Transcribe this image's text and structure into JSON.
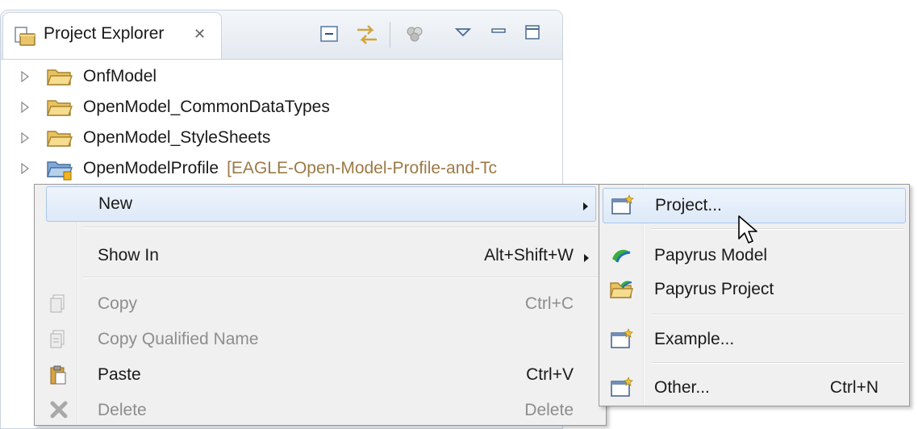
{
  "view": {
    "tab_label": "Project Explorer",
    "tab_close_glyph": "✕",
    "toolbar": [
      "collapse-all-icon",
      "link-with-editor-icon",
      "filters-icon",
      "view-menu-icon",
      "minimize-icon",
      "maximize-icon"
    ]
  },
  "tree": [
    {
      "label": "OnfModel",
      "decoration": "",
      "icon": "folder-icon"
    },
    {
      "label": "OpenModel_CommonDataTypes",
      "decoration": "",
      "icon": "folder-icon"
    },
    {
      "label": "OpenModel_StyleSheets",
      "decoration": "",
      "icon": "folder-icon"
    },
    {
      "label": "OpenModelProfile",
      "decoration": "[EAGLE-Open-Model-Profile-and-Tc",
      "icon": "shared-project-icon"
    }
  ],
  "context_menu": {
    "items": [
      {
        "label": "New",
        "shortcut": "",
        "submenu": true,
        "enabled": true
      },
      {
        "label": "Show In",
        "shortcut": "Alt+Shift+W",
        "submenu": true,
        "enabled": true
      },
      {
        "label": "Copy",
        "shortcut": "Ctrl+C",
        "submenu": false,
        "enabled": false,
        "icon": "copy-icon"
      },
      {
        "label": "Copy Qualified Name",
        "shortcut": "",
        "submenu": false,
        "enabled": false,
        "icon": "copy-qualified-name-icon"
      },
      {
        "label": "Paste",
        "shortcut": "Ctrl+V",
        "submenu": false,
        "enabled": true,
        "icon": "paste-icon"
      },
      {
        "label": "Delete",
        "shortcut": "Delete",
        "submenu": false,
        "enabled": false,
        "icon": "delete-icon"
      }
    ]
  },
  "submenu_new": {
    "items": [
      {
        "label": "Project...",
        "shortcut": "",
        "icon": "new-project-icon"
      },
      {
        "label": "Papyrus Model",
        "shortcut": "",
        "icon": "papyrus-model-icon"
      },
      {
        "label": "Papyrus Project",
        "shortcut": "",
        "icon": "papyrus-project-icon"
      },
      {
        "label": "Example...",
        "shortcut": "",
        "icon": "new-example-icon"
      },
      {
        "label": "Other...",
        "shortcut": "Ctrl+N",
        "icon": "new-other-icon"
      }
    ]
  },
  "colors": {
    "highlight_bg": "#dde9f8",
    "highlight_border": "#a8c6ee",
    "menu_bg": "#f0f0f0",
    "disabled_text": "#8d8d8d",
    "decoration_text": "#9c7a45"
  }
}
